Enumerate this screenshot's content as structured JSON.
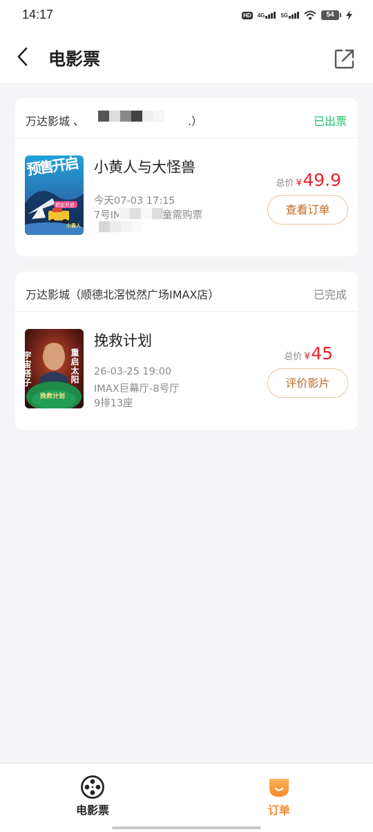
{
  "status_bar": {
    "time": "14:17",
    "hd_label": "HD",
    "net_4g": "4G",
    "net_5g": "5G",
    "battery": "54"
  },
  "header": {
    "title": "电影票",
    "back_icon": "chevron-left-icon",
    "share_icon": "share-icon"
  },
  "orders": [
    {
      "cinema": "万达影城 、",
      "cinema_tail": ".）",
      "status": "已出票",
      "status_color": "#1cbf6b",
      "title": "小黄人与大怪兽",
      "line1": "今天07-03 17:15",
      "line2": "7号IM",
      "line2_tail": "儿童需购票",
      "price_label": "总价",
      "currency": "¥",
      "price": "49.9",
      "action": "查看订单",
      "poster_text": "预售开启",
      "poster_badge": "预定开启",
      "poster_small": "小黄人"
    },
    {
      "cinema": "万达影城（顺德北滘悦然广场IMAX店）",
      "status": "已完成",
      "status_color": "#888888",
      "title": "挽救计划",
      "line1": "26-03-25 19:00",
      "line2": "IMAX巨幕厅-8号厅",
      "line3": "9排13座",
      "price_label": "总价",
      "currency": "¥",
      "price": "45",
      "action": "评价影片",
      "poster_left": "宇宙搭子",
      "poster_right": "重启太阳",
      "poster_title": "挽救计划"
    }
  ],
  "tabs": [
    {
      "label": "电影票",
      "icon": "film-reel-icon",
      "active": false
    },
    {
      "label": "订单",
      "icon": "orders-icon",
      "active": true
    }
  ],
  "colors": {
    "accent": "#f08a2b",
    "price": "#e8232c",
    "success": "#1cbf6b"
  }
}
